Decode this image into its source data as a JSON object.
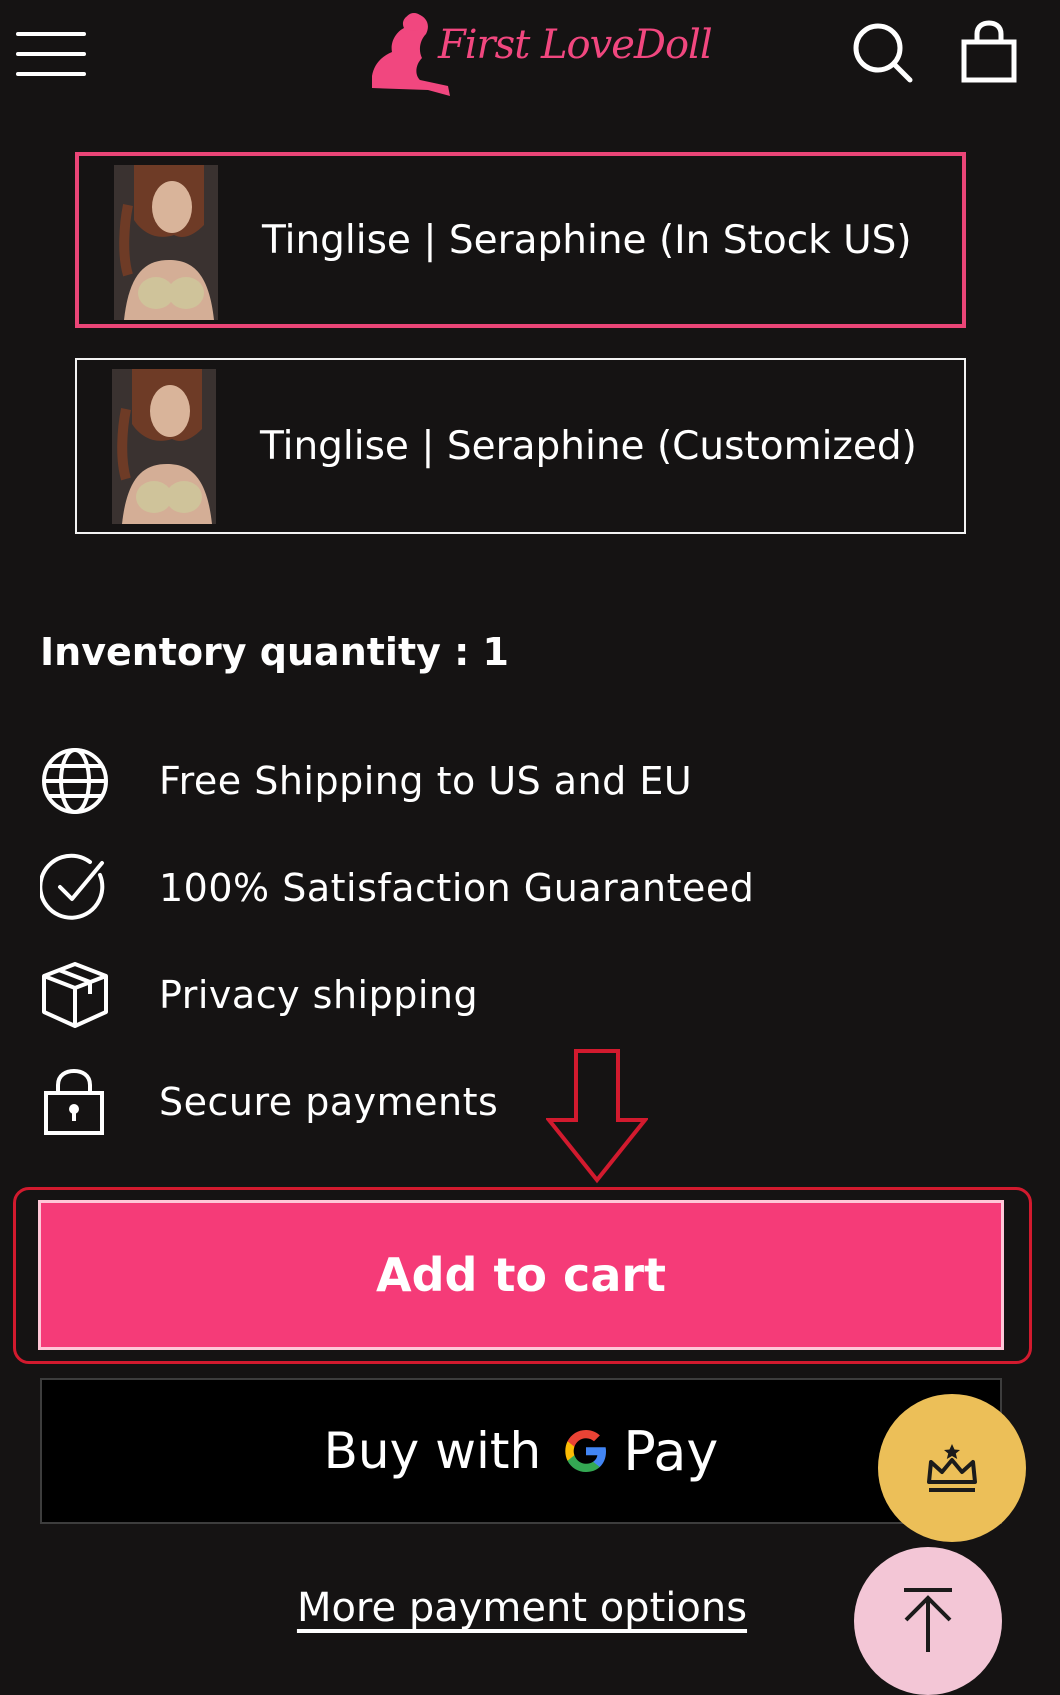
{
  "header": {
    "logo_text": "First LoveDoll",
    "icons": [
      "menu-icon",
      "search-icon",
      "shopping-bag-icon"
    ]
  },
  "variants": [
    {
      "label": "Tinglise | Seraphine (In Stock US)",
      "selected": true
    },
    {
      "label": "Tinglise | Seraphine (Customized)",
      "selected": false
    }
  ],
  "inventory": {
    "text": "Inventory quantity : 1"
  },
  "features": [
    {
      "icon": "globe-icon",
      "text": "Free Shipping to US and EU"
    },
    {
      "icon": "check-circle-icon",
      "text": "100% Satisfaction Guaranteed"
    },
    {
      "icon": "box-icon",
      "text": "Privacy shipping"
    },
    {
      "icon": "lock-icon",
      "text": "Secure payments"
    }
  ],
  "actions": {
    "add_to_cart": "Add to cart",
    "gpay_buy": "Buy with",
    "gpay_pay": "Pay",
    "more_payment": "More payment options"
  },
  "colors": {
    "background": "#151313",
    "accent_pink": "#f53b78",
    "selected_border": "#ea4577",
    "annotation_red": "#d21a2e",
    "rewards_gold": "#ecbf58",
    "to_top_pink": "#f3c6d6"
  }
}
